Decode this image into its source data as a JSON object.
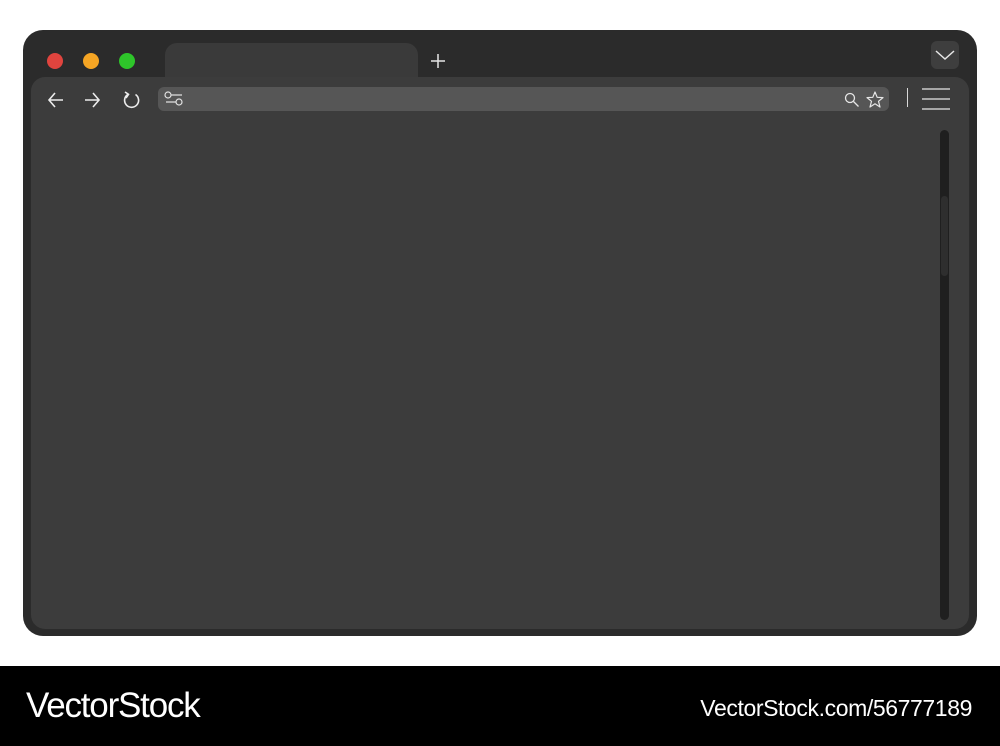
{
  "window": {
    "controls": {
      "close_color": "#e0443e",
      "minimize_color": "#f5a524",
      "maximize_color": "#2ec52a"
    },
    "tab": {
      "title": ""
    },
    "new_tab_icon": "plus-icon",
    "tabs_dropdown_icon": "chevron-down-icon"
  },
  "toolbar": {
    "back_icon": "arrow-left-icon",
    "forward_icon": "arrow-right-icon",
    "reload_icon": "reload-icon",
    "address_bar": {
      "value": "",
      "placeholder": "",
      "site_icon": "site-settings-icon",
      "search_icon": "search-icon",
      "bookmark_icon": "star-icon"
    },
    "menu_icon": "hamburger-menu-icon"
  },
  "scrollbar": {
    "position": 0.13
  },
  "watermark": {
    "brand": "VectorStock",
    "image_id": "VectorStock.com/56777189"
  }
}
